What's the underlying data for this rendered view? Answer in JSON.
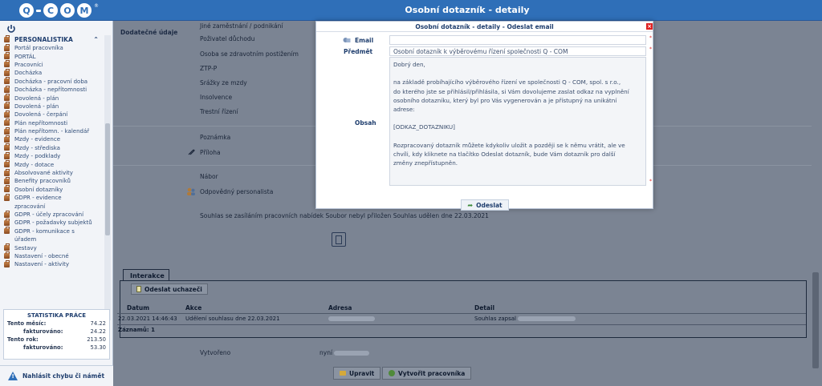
{
  "header": {
    "title": "Osobní dotazník - detaily"
  },
  "logo": {
    "text": "Q-COM"
  },
  "sidebar": {
    "section": "PERSONALISTIKA",
    "items": [
      "Portál pracovníka",
      "PORTÁL",
      "Pracovníci",
      "Docházka",
      "Docházka - pracovní doba",
      "Docházka - nepřítomnosti",
      "Dovolená - plán",
      "Dovolená - plán",
      "Dovolená - čerpání",
      "Plán nepřítomnosti",
      "Plán nepřítomn. - kalendář",
      "Mzdy - evidence",
      "Mzdy - střediska",
      "Mzdy - podklady",
      "Mzdy - dotace",
      "Absolvované aktivity",
      "Benefity pracovníků",
      "Osobní dotazníky",
      "GDPR - evidence",
      "zpracování",
      "GDPR - účely zpracování",
      "GDPR - požadavky subjektů",
      "GDPR - komunikace s",
      "úřadem",
      "Sestavy",
      "Nastavení - obecné",
      "Nastavení - aktivity"
    ],
    "stats": {
      "title": "STATISTIKA PRÁCE",
      "rows": [
        {
          "label": "Tento měsíc:",
          "value": "74.22"
        },
        {
          "label": "fakturováno:",
          "value": "24.22"
        },
        {
          "label": "Tento rok:",
          "value": "213.50"
        },
        {
          "label": "fakturováno:",
          "value": "53.30"
        }
      ]
    },
    "report": "Nahlásit chybu či námět"
  },
  "main": {
    "section_label": "Dodatečné údaje",
    "fields": [
      "Jiné zaměstnání / podnikání",
      "Poživatel důchodu",
      "Osoba se zdravotním postižením",
      "ZTP-P",
      "Srážky ze mzdy",
      "Insolvence",
      "Trestní řízení"
    ],
    "note": "Poznámka",
    "attachment": "Příloha",
    "recruitment": "Nábor",
    "responsible": "Odpovědný personalista",
    "consent": "Souhlas se zasíláním pracovních nabídek  Soubor nebyl přiložen Souhlas udělen dne 22.03.2021",
    "interactions": {
      "tab": "Interakce",
      "send_button": "Odeslat uchazeči",
      "columns": [
        "Datum",
        "Akce",
        "Adresa",
        "Detail"
      ],
      "row": {
        "date": "22.03.2021 14:46:43",
        "action": "Udělení souhlasu dne 22.03.2021",
        "detail": "Souhlas zapsal"
      },
      "count": "Záznamů: 1"
    },
    "created_label": "Vytvořeno",
    "created_value": "nyní",
    "btn_edit": "Upravit",
    "btn_create": "Vytvořit pracovníka"
  },
  "modal": {
    "title": "Osobní dotazník - detaily - Odeslat email",
    "email_label": "Email",
    "email_value": "",
    "subject_label": "Předmět",
    "subject_value": "Osobní dotazník k výběrovému řízení společnosti Q - COM",
    "body_label": "Obsah",
    "body": "Dobrý den,\n\nna základě probíhajícího výběrového řízení ve společnosti Q - COM, spol. s r.o.,\ndo kterého jste se přihlásil/přihlásila, si Vám dovolujeme zaslat odkaz na vyplnění\nosobního dotazníku, který byl pro Vás vygenerován a je přístupný na unikátní\nadrese:\n\n[ODKAZ_DOTAZNIKU]\n\nRozpracovaný dotazník můžete kdykoliv uložit a později se k němu vrátit, ale ve\nchvíli, kdy kliknete na tlačítko Odeslat dotazník, bude Vám dotazník pro další\nzměny znepřístupněn.",
    "send_label": "Odeslat"
  }
}
